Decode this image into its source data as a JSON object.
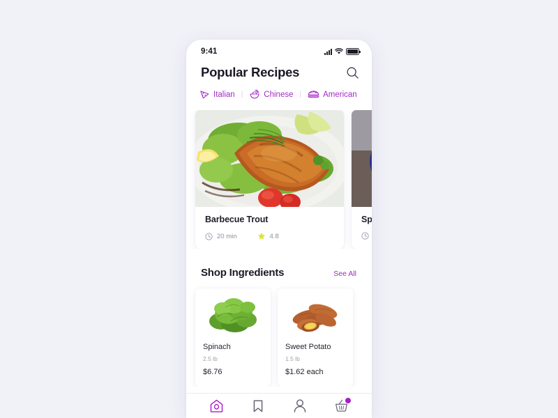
{
  "theme": {
    "background": "#f1f1f8",
    "accent": "#a22bc6",
    "card": "#ffffff",
    "text_primary": "#1a1a26",
    "text_muted": "#8d8d9c",
    "star": "#dde231"
  },
  "status_bar": {
    "time": "9:41",
    "icons": [
      "signal-icon",
      "wifi-icon",
      "battery-icon"
    ]
  },
  "header": {
    "title": "Popular Recipes",
    "search_icon": "search-icon"
  },
  "categories": [
    {
      "label": "Italian",
      "icon": "pizza-slice-icon"
    },
    {
      "label": "Chinese",
      "icon": "noodle-bowl-icon"
    },
    {
      "label": "American",
      "icon": "burger-icon"
    }
  ],
  "category_separator": "|",
  "recipes": [
    {
      "name": "Barbecue Trout",
      "time": "20 min",
      "rating": "4.8",
      "clock_icon": "clock-icon",
      "star_icon": "star-icon",
      "photo": "grilled-trout-on-salad"
    },
    {
      "name": "Sp",
      "time": "",
      "rating": "",
      "clock_icon": "clock-icon",
      "star_icon": "star-icon",
      "photo": "blue-plate-dish"
    }
  ],
  "shop": {
    "title": "Shop Ingredients",
    "see_all_label": "See All",
    "products": [
      {
        "name": "Spinach",
        "weight": "2.5 lb",
        "price": "$6.76",
        "photo": "spinach-leaves"
      },
      {
        "name": "Sweet Potato",
        "weight": "1.5 lb",
        "price": "$1.62 each",
        "photo": "sweet-potatoes"
      }
    ]
  },
  "bottom_nav": [
    {
      "name": "home",
      "icon": "home-icon",
      "active": true,
      "badge": false
    },
    {
      "name": "saved",
      "icon": "bookmark-icon",
      "active": false,
      "badge": false
    },
    {
      "name": "profile",
      "icon": "user-icon",
      "active": false,
      "badge": false
    },
    {
      "name": "cart",
      "icon": "basket-icon",
      "active": false,
      "badge": true
    }
  ]
}
